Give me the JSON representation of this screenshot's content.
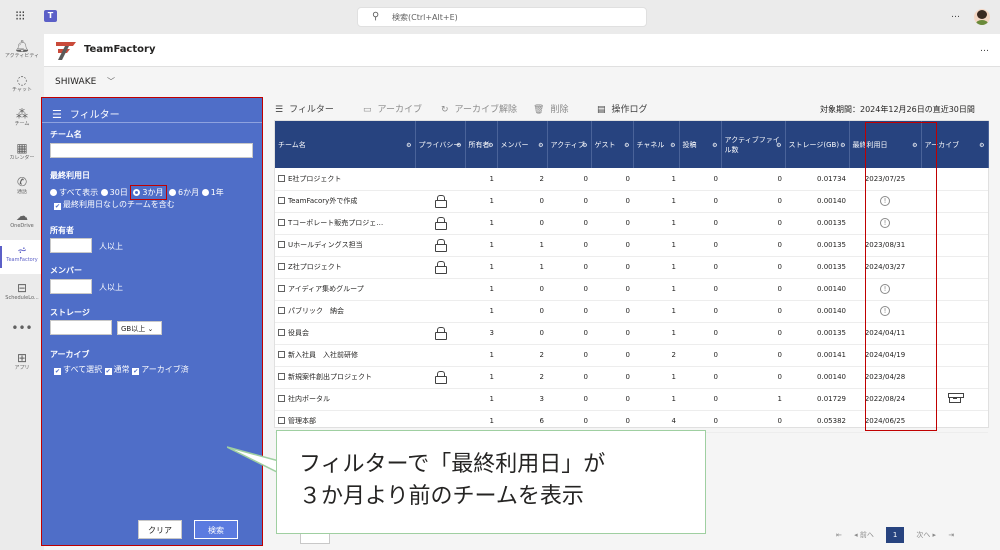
{
  "topbar": {
    "search_placeholder": "検索(Ctrl+Alt+E)",
    "more": "…"
  },
  "rail": {
    "items": [
      {
        "label": "アクティビティ",
        "icon": "bell-icon"
      },
      {
        "label": "チャット",
        "icon": "chat-icon"
      },
      {
        "label": "チーム",
        "icon": "teams-icon"
      },
      {
        "label": "カレンダー",
        "icon": "calendar-icon"
      },
      {
        "label": "通話",
        "icon": "phone-icon"
      },
      {
        "label": "OneDrive",
        "icon": "cloud-icon"
      },
      {
        "label": "TeamFactory",
        "icon": "teamfactory-icon"
      },
      {
        "label": "ScheduleLo...",
        "icon": "schedule-icon"
      },
      {
        "label": "•••",
        "icon": "more-icon"
      },
      {
        "label": "アプリ",
        "icon": "apps-icon"
      }
    ]
  },
  "app": {
    "title": "TeamFactory",
    "more": "…",
    "org": "SHIWAKE",
    "org_chevron": "﹀"
  },
  "filter": {
    "title": "フィルター",
    "team_name_label": "チーム名",
    "last_used_label": "最終利用日",
    "radio_options": [
      "すべて表示",
      "30日",
      "3か月",
      "6か月",
      "1年"
    ],
    "selected_option": "3か月",
    "include_unused_label": "最終利用日なしのチームを含む",
    "owner_label": "所有者",
    "owner_suffix": "人以上",
    "member_label": "メンバー",
    "member_suffix": "人以上",
    "storage_label": "ストレージ",
    "storage_unit": "GB以上 ⌄",
    "archive_label": "アーカイブ",
    "archive_options": [
      "すべて選択",
      "通常",
      "アーカイブ済"
    ],
    "clear_button": "クリア",
    "search_button": "検索"
  },
  "toolbar": {
    "filter": "フィルター",
    "archive": "アーカイブ",
    "unarchive": "アーカイブ解除",
    "delete": "削除",
    "log": "操作ログ",
    "period": "対象期間：2024年12月26日の直近30日間"
  },
  "table": {
    "columns": [
      "チーム名",
      "プライバシー",
      "所有者",
      "メンバー",
      "アクティブ",
      "ゲスト",
      "チャネル",
      "投稿",
      "アクティブファイル数",
      "ストレージ(GB)",
      "最終利用日",
      "アーカイブ"
    ],
    "rows": [
      {
        "name": "E社プロジェクト",
        "private": false,
        "owners": "1",
        "members": "2",
        "active": "0",
        "guests": "0",
        "channels": "1",
        "posts": "0",
        "files": "0",
        "storage": "0.01734",
        "last_used": "2023/07/25",
        "archived": false
      },
      {
        "name": "TeamFacory外で作成",
        "private": true,
        "owners": "1",
        "members": "0",
        "active": "0",
        "guests": "0",
        "channels": "1",
        "posts": "0",
        "files": "0",
        "storage": "0.00140",
        "last_used": "",
        "archived": false
      },
      {
        "name": "Tコーポレート販売プロジェ…",
        "private": true,
        "owners": "1",
        "members": "0",
        "active": "0",
        "guests": "0",
        "channels": "1",
        "posts": "0",
        "files": "0",
        "storage": "0.00135",
        "last_used": "",
        "archived": false
      },
      {
        "name": "Uホールディングス担当",
        "private": true,
        "owners": "1",
        "members": "1",
        "active": "0",
        "guests": "0",
        "channels": "1",
        "posts": "0",
        "files": "0",
        "storage": "0.00135",
        "last_used": "2023/08/31",
        "archived": false
      },
      {
        "name": "Z社プロジェクト",
        "private": true,
        "owners": "1",
        "members": "1",
        "active": "0",
        "guests": "0",
        "channels": "1",
        "posts": "0",
        "files": "0",
        "storage": "0.00135",
        "last_used": "2024/03/27",
        "archived": false
      },
      {
        "name": "アイディア集めグループ",
        "private": false,
        "owners": "1",
        "members": "0",
        "active": "0",
        "guests": "0",
        "channels": "1",
        "posts": "0",
        "files": "0",
        "storage": "0.00140",
        "last_used": "",
        "archived": false
      },
      {
        "name": "パブリック　納会",
        "private": false,
        "owners": "1",
        "members": "0",
        "active": "0",
        "guests": "0",
        "channels": "1",
        "posts": "0",
        "files": "0",
        "storage": "0.00140",
        "last_used": "",
        "archived": false
      },
      {
        "name": "役員会",
        "private": true,
        "owners": "3",
        "members": "0",
        "active": "0",
        "guests": "0",
        "channels": "1",
        "posts": "0",
        "files": "0",
        "storage": "0.00135",
        "last_used": "2024/04/11",
        "archived": false
      },
      {
        "name": "新入社員　入社前研修",
        "private": false,
        "owners": "1",
        "members": "2",
        "active": "0",
        "guests": "0",
        "channels": "2",
        "posts": "0",
        "files": "0",
        "storage": "0.00141",
        "last_used": "2024/04/19",
        "archived": false
      },
      {
        "name": "新規案件創出プロジェクト",
        "private": true,
        "owners": "1",
        "members": "2",
        "active": "0",
        "guests": "0",
        "channels": "1",
        "posts": "0",
        "files": "0",
        "storage": "0.00140",
        "last_used": "2023/04/28",
        "archived": false
      },
      {
        "name": "社内ポータル",
        "private": false,
        "owners": "1",
        "members": "3",
        "active": "0",
        "guests": "0",
        "channels": "1",
        "posts": "0",
        "files": "1",
        "storage": "0.01729",
        "last_used": "2022/08/24",
        "archived": true
      },
      {
        "name": "管理本部",
        "private": false,
        "owners": "1",
        "members": "6",
        "active": "0",
        "guests": "0",
        "channels": "4",
        "posts": "0",
        "files": "0",
        "storage": "0.05382",
        "last_used": "2024/06/25",
        "archived": false
      }
    ]
  },
  "pager": {
    "first": "⇤",
    "prev": "◂ 前へ",
    "current": "1",
    "next": "次へ ▸",
    "last": "⇥"
  },
  "callout": {
    "line1": "フィルターで「最終利用日」が",
    "line2": "３か月より前のチームを表示"
  },
  "colors": {
    "filter_panel": "#4f6ec8",
    "table_header": "#27437f",
    "highlight": "#c00000",
    "callout_border": "#9fcfa1"
  }
}
